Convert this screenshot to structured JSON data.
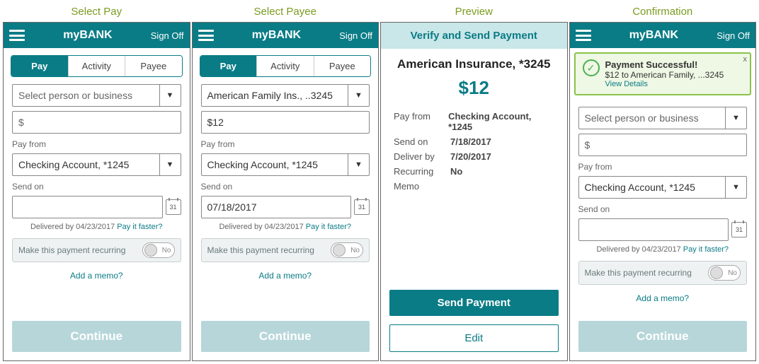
{
  "titles": {
    "c1": "Select Pay",
    "c2": "Select Payee",
    "c3": "Preview",
    "c4": "Confirmation"
  },
  "header": {
    "brand": "myBANK",
    "signoff": "Sign Off"
  },
  "tabs": {
    "pay": "Pay",
    "activity": "Activity",
    "payee": "Payee"
  },
  "payee": {
    "placeholder": "Select person or business",
    "selected": "American Family Ins., ..3245"
  },
  "amount": {
    "empty": "$",
    "filled": "$12"
  },
  "payfrom": {
    "label": "Pay from",
    "value": "Checking Account, *1245"
  },
  "sendon": {
    "label": "Send on",
    "value": "07/18/2017",
    "cal": "31"
  },
  "delivered": {
    "text": "Delivered by 04/23/2017",
    "link": "Pay it faster?"
  },
  "recurring": {
    "text": "Make this payment recurring",
    "state": "No"
  },
  "memo_link": "Add a memo?",
  "buttons": {
    "continue": "Continue",
    "send": "Send Payment",
    "edit": "Edit"
  },
  "verify": {
    "title": "Verify and Send Payment",
    "payee": "American Insurance, *3245",
    "amount": "$12",
    "rows": {
      "payfrom_k": "Pay from",
      "payfrom_v": "Checking Account, *1245",
      "sendon_k": "Send on",
      "sendon_v": "7/18/2017",
      "deliver_k": "Deliver by",
      "deliver_v": "7/20/2017",
      "recur_k": "Recurring",
      "recur_v": "No",
      "memo_k": "Memo",
      "memo_v": ""
    }
  },
  "success": {
    "title": "Payment Successful!",
    "detail": "$12 to American Family, ...3245",
    "link": "View Details",
    "close": "x"
  }
}
